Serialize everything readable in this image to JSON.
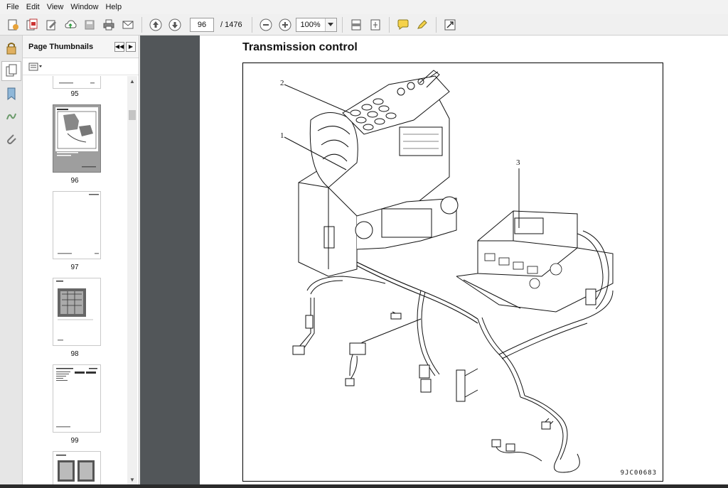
{
  "menu": [
    "File",
    "Edit",
    "View",
    "Window",
    "Help"
  ],
  "toolbar": {
    "current_page": "96",
    "page_total": "/ 1476",
    "zoom": "100%"
  },
  "icons": {
    "create": "create-pdf-icon",
    "print": "print-icon",
    "prev": "arrow-up-icon",
    "next": "arrow-down-icon",
    "zoom_out": "minus-circle-icon",
    "zoom_in": "plus-circle-icon"
  },
  "panel": {
    "title": "Page Thumbnails",
    "thumbnails": [
      {
        "label": "95"
      },
      {
        "label": "96"
      },
      {
        "label": "97"
      },
      {
        "label": "98"
      },
      {
        "label": "99"
      }
    ]
  },
  "document": {
    "title": "Transmission control",
    "figure_code": "9JC00683",
    "callouts": [
      "1",
      "2",
      "3"
    ]
  }
}
